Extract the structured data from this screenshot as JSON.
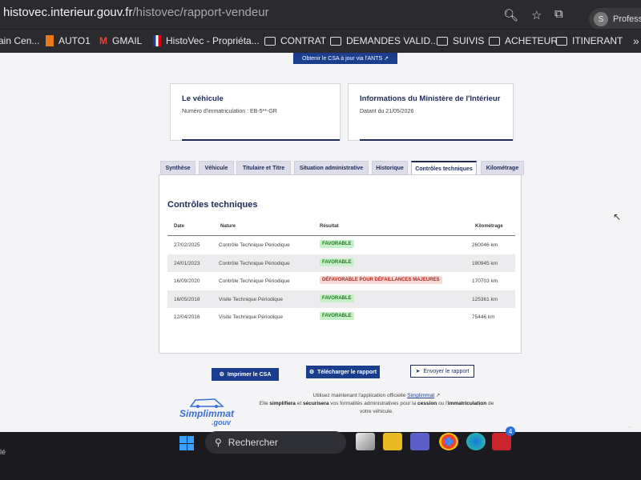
{
  "browser": {
    "url_host": "histovec.interieur.gouv.fr",
    "url_path": "/histovec/rapport-vendeur",
    "profile_initial": "S",
    "profile_label": "Professi",
    "bookmarks": [
      "ain Cen...",
      "AUTO1",
      "GMAIL",
      "HistoVec - Propriéta...",
      "CONTRAT",
      "DEMANDES VALID...",
      "SUIVIS",
      "ACHETEUR",
      "ITINERANT"
    ]
  },
  "page": {
    "csa_top_button": "Obtenir le CSA à jour via l'ANTS",
    "vehicle_card": {
      "title": "Le véhicule",
      "plate_text": "Numéro d'immatriculation : EB-5**-GR"
    },
    "ministry_card": {
      "title": "Informations du Ministère de l'Intérieur",
      "date_text": "Datant du 21/05/2026"
    },
    "tabs": [
      "Synthèse",
      "Véhicule",
      "Titulaire et Titre",
      "Situation administrative",
      "Historique",
      "Contrôles techniques",
      "Kilométrage"
    ],
    "active_tab": "Contrôles techniques",
    "section_title": "Contrôles techniques",
    "table": {
      "headers": {
        "date": "Date",
        "nature": "Nature",
        "result": "Résultat",
        "km": "Kilométrage"
      },
      "rows": [
        {
          "date": "27/02/2025",
          "nature": "Contrôle Technique Périodique",
          "result": "FAVORABLE",
          "status": "ok",
          "km": "260046 km"
        },
        {
          "date": "24/01/2023",
          "nature": "Contrôle Technique Périodique",
          "result": "FAVORABLE",
          "status": "ok",
          "km": "190945 km"
        },
        {
          "date": "16/09/2020",
          "nature": "Contrôle Technique Périodique",
          "result": "DÉFAVORABLE POUR DÉFAILLANCES MAJEURES",
          "status": "ko",
          "km": "170703 km"
        },
        {
          "date": "16/05/2018",
          "nature": "Visite Technique Périodique",
          "result": "FAVORABLE",
          "status": "ok",
          "km": "125361 km"
        },
        {
          "date": "12/04/2016",
          "nature": "Visite Technique Périodique",
          "result": "FAVORABLE",
          "status": "ok",
          "km": "75446 km"
        }
      ]
    },
    "actions": {
      "print_csa": "Imprimer le CSA",
      "download_report": "Télécharger le rapport",
      "send_report": "Envoyer le rapport"
    },
    "promo": {
      "logo_main": "Simplimmat",
      "logo_sub": ".gouv",
      "line1_prefix": "Utilisez maintenant l'application officielle ",
      "line1_link": "Simplimmat",
      "line2_a": "Elle ",
      "line2_b1": "simplifiera",
      "line2_c": " et ",
      "line2_b2": "sécurisera",
      "line2_d": " vos formalités administratives pour la ",
      "line2_b3": "cession",
      "line2_e": " ou l'",
      "line2_b4": "immatriculation",
      "line2_f": " de",
      "line3": "votre véhicule."
    }
  },
  "taskbar": {
    "left_text": "lé",
    "search_placeholder": "Rechercher",
    "notification_count": "4"
  }
}
